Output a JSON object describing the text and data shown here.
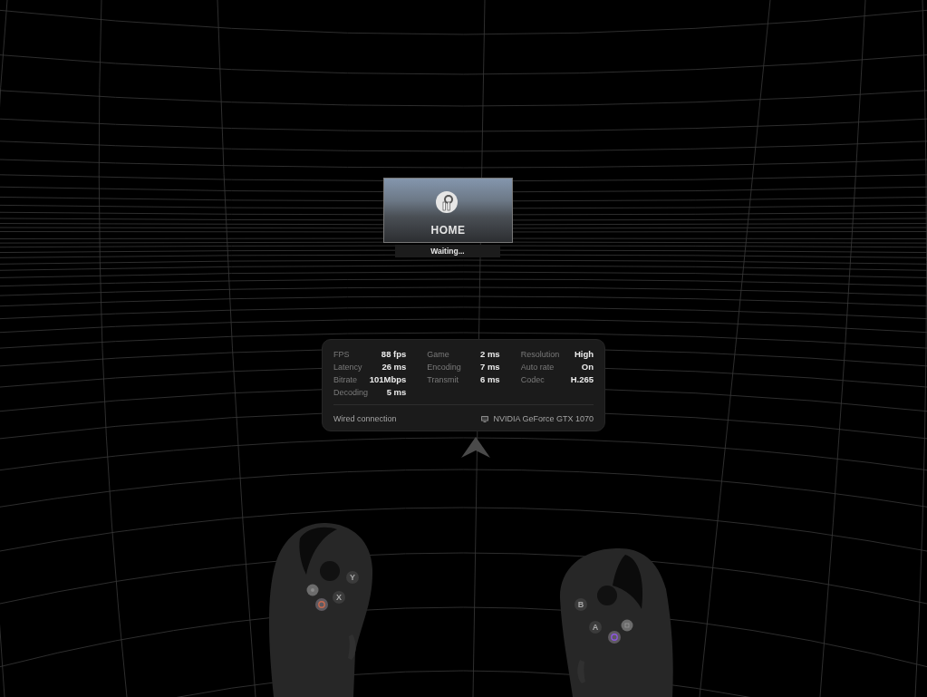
{
  "home_card": {
    "title": "HOME",
    "status": "Waiting..."
  },
  "stats_panel": {
    "columns": [
      [
        {
          "label": "FPS",
          "value": "88 fps"
        },
        {
          "label": "Latency",
          "value": "26 ms"
        },
        {
          "label": "Bitrate",
          "value": "101Mbps"
        },
        {
          "label": "Decoding",
          "value": "5 ms"
        }
      ],
      [
        {
          "label": "Game",
          "value": "2 ms"
        },
        {
          "label": "Encoding",
          "value": "7 ms"
        },
        {
          "label": "Transmit",
          "value": "6 ms"
        }
      ],
      [
        {
          "label": "Resolution",
          "value": "High"
        },
        {
          "label": "Auto rate",
          "value": "On"
        },
        {
          "label": "Codec",
          "value": "H.265"
        }
      ]
    ],
    "connection": "Wired connection",
    "gpu": "NVIDIA GeForce GTX 1070"
  },
  "controllers": [
    {
      "kind": "left",
      "buttons": [
        "Y",
        "X"
      ]
    },
    {
      "kind": "right",
      "buttons": [
        "B",
        "A"
      ]
    }
  ]
}
